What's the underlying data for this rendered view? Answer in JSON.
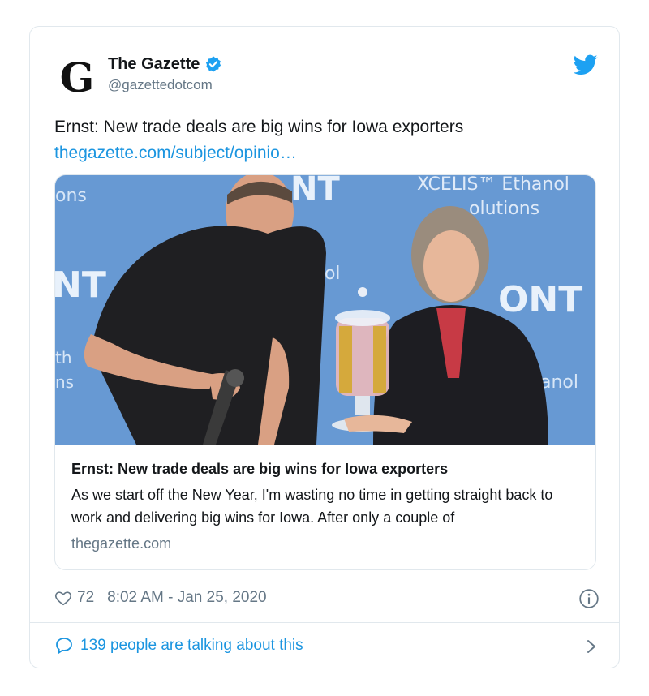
{
  "account": {
    "display_name": "The Gazette",
    "handle": "@gazettedotcom",
    "logo_glyph": "G",
    "verified": true
  },
  "tweet": {
    "text": "Ernst: New trade deals are big wins for Iowa exporters",
    "link_text": "thegazette.com/subject/opinio…"
  },
  "card": {
    "image_text": {
      "top_left": "ons",
      "top_banner": "XCELIS™ Ethanol",
      "top_banner_sub": "olutions",
      "left_mid": "NT",
      "left_mid2": "th",
      "left_bottom": "ns",
      "center_mid": "nol",
      "right_mid": "ONT",
      "right_bottom": "anol",
      "center_top": "NT"
    },
    "title": "Ernst: New trade deals are big wins for Iowa exporters",
    "description": "As we start off the New Year, I'm wasting no time in getting straight back to work and delivering big wins for Iowa. After only a couple of",
    "domain": "thegazette.com"
  },
  "meta": {
    "likes": "72",
    "timestamp": "8:02 AM - Jan 25, 2020"
  },
  "footer": {
    "talking_text": "139 people are talking about this"
  },
  "colors": {
    "accent": "#1b95e0",
    "muted": "#657786",
    "border": "#e1e8ed",
    "photo_bg": "#6f9fd6"
  },
  "icons": [
    "gazette-logo-icon",
    "verified-badge-icon",
    "twitter-bird-icon",
    "heart-icon",
    "info-icon",
    "chat-bubble-icon",
    "chevron-right-icon"
  ]
}
